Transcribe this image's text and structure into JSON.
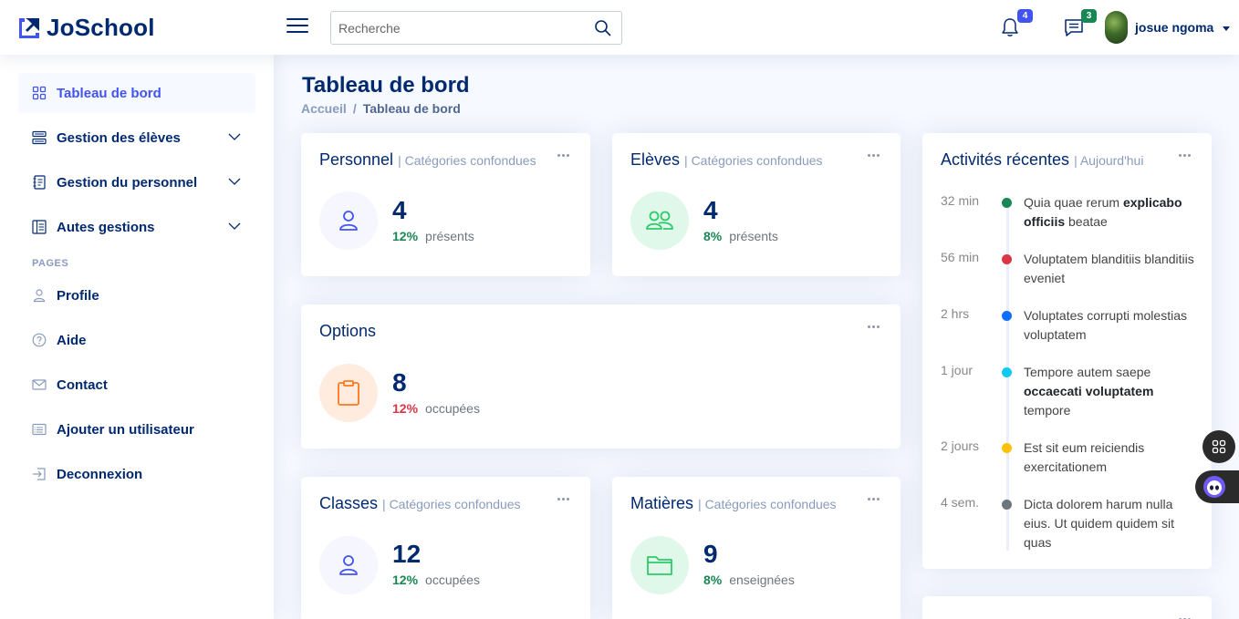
{
  "brand": {
    "name": "JoSchool"
  },
  "search": {
    "placeholder": "Recherche"
  },
  "header": {
    "notifications_count": "4",
    "messages_count": "3",
    "user_name": "josue ngoma"
  },
  "sidebar": {
    "items": [
      {
        "label": "Tableau de bord",
        "icon": "grid-icon"
      },
      {
        "label": "Gestion des élèves",
        "icon": "layout-list-icon"
      },
      {
        "label": "Gestion du personnel",
        "icon": "journal-text-icon"
      },
      {
        "label": "Autes gestions",
        "icon": "layout-text-icon"
      }
    ],
    "pages_heading": "PAGES",
    "pages": [
      {
        "label": "Profile",
        "icon": "person-icon"
      },
      {
        "label": "Aide",
        "icon": "question-circle-icon"
      },
      {
        "label": "Contact",
        "icon": "envelope-icon"
      },
      {
        "label": "Ajouter un utilisateur",
        "icon": "card-list-icon"
      },
      {
        "label": "Deconnexion",
        "icon": "box-arrow-in-right-icon"
      }
    ]
  },
  "page": {
    "title": "Tableau de bord",
    "breadcrumb": [
      "Accueil",
      "/",
      "Tableau de bord"
    ]
  },
  "cards": {
    "personnel": {
      "title": "Personnel",
      "sub": "| Catégories confondues",
      "value": "4",
      "pct": "12%",
      "label": "présents"
    },
    "eleves": {
      "title": "Elèves",
      "sub": "| Catégories confondues",
      "value": "4",
      "pct": "8%",
      "label": "présents"
    },
    "options": {
      "title": "Options",
      "value": "8",
      "pct": "12%",
      "label": "occupées"
    },
    "classes": {
      "title": "Classes",
      "sub": "| Catégories confondues",
      "value": "12",
      "pct": "12%",
      "label": "occupées"
    },
    "matieres": {
      "title": "Matières",
      "sub": "| Catégories confondues",
      "value": "9",
      "pct": "8%",
      "label": "enseignées"
    }
  },
  "activities": {
    "title": "Activités récentes",
    "sub": "| Aujourd'hui",
    "items": [
      {
        "time": "32 min",
        "color": "#198754",
        "text_pre": "Quia quae rerum ",
        "text_bold": "explicabo officiis",
        "text_post": " beatae"
      },
      {
        "time": "56 min",
        "color": "#dc3545",
        "text_pre": "Voluptatem blanditiis blanditiis eveniet",
        "text_bold": "",
        "text_post": ""
      },
      {
        "time": "2 hrs",
        "color": "#0d6efd",
        "text_pre": "Voluptates corrupti molestias voluptatem",
        "text_bold": "",
        "text_post": ""
      },
      {
        "time": "1 jour",
        "color": "#0dcaf0",
        "text_pre": "Tempore autem saepe ",
        "text_bold": "occaecati voluptatem",
        "text_post": " tempore"
      },
      {
        "time": "2 jours",
        "color": "#ffc107",
        "text_pre": "Est sit eum reiciendis exercitationem",
        "text_bold": "",
        "text_post": ""
      },
      {
        "time": "4 sem.",
        "color": "#6c757d",
        "text_pre": "Dicta dolorem harum nulla eius. Ut quidem quidem sit quas",
        "text_bold": "",
        "text_post": ""
      }
    ]
  },
  "colors": {
    "primary": "#012970",
    "accent": "#4154f1",
    "muted": "#899bbd"
  }
}
